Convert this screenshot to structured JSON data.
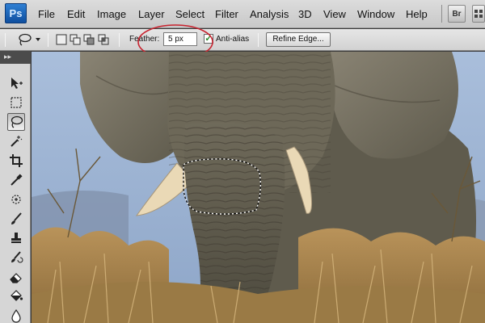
{
  "app": {
    "logo_text": "Ps"
  },
  "menu": {
    "items": [
      "File",
      "Edit",
      "Image",
      "Layer",
      "Select",
      "Filter",
      "Analysis",
      "3D",
      "View",
      "Window",
      "Help"
    ],
    "bridge_label": "Br"
  },
  "options": {
    "feather_label": "Feather:",
    "feather_value": "5 px",
    "anti_alias_label": "Anti-alias",
    "anti_alias_checked": true,
    "refine_edge_label": "Refine Edge...",
    "highlight_color": "#c8232f"
  },
  "tools": {
    "header_glyph": "▸▸",
    "list": [
      {
        "name": "move-tool-icon"
      },
      {
        "name": "rectangular-marquee-tool-icon"
      },
      {
        "name": "lasso-tool-icon",
        "active": true
      },
      {
        "name": "magic-wand-tool-icon"
      },
      {
        "name": "crop-tool-icon"
      },
      {
        "name": "eyedropper-tool-icon"
      },
      {
        "name": "spot-healing-brush-tool-icon"
      },
      {
        "name": "brush-tool-icon"
      },
      {
        "name": "clone-stamp-tool-icon"
      },
      {
        "name": "history-brush-tool-icon"
      },
      {
        "name": "eraser-tool-icon"
      },
      {
        "name": "paint-bucket-tool-icon"
      },
      {
        "name": "blur-tool-icon"
      }
    ]
  },
  "colors": {
    "menubar": "#d0d0d0",
    "sky": "#9fb4d1",
    "elephant": "#6e6858",
    "grass": "#b08a52"
  }
}
